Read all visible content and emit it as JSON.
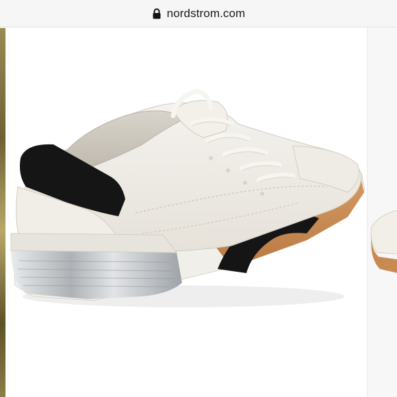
{
  "browser": {
    "url": "nordstrom.com",
    "lock_icon": "lock-icon"
  },
  "gallery": {
    "main_image": "white-leather-sneaker-product-photo",
    "next_image": "sneaker-thumbnail-peek",
    "prev_image": "gold-thumbnail-peek"
  },
  "colors": {
    "toolbar_bg": "#f6f6f6",
    "sole_gum": "#c98a52",
    "accent_black": "#151515",
    "leather_white": "#efece6",
    "metallic_silver": "#c9ccd0"
  }
}
